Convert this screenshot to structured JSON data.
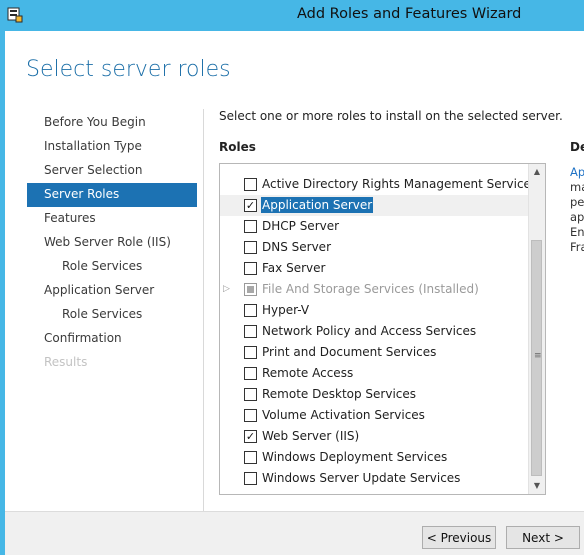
{
  "window": {
    "title": "Add Roles and Features Wizard",
    "icon": "server-manager-icon",
    "accent_color": "#46b7e6"
  },
  "page": {
    "title": "Select server roles"
  },
  "nav": {
    "items": [
      {
        "label": "Before You Begin",
        "level": 0,
        "state": "normal"
      },
      {
        "label": "Installation Type",
        "level": 0,
        "state": "normal"
      },
      {
        "label": "Server Selection",
        "level": 0,
        "state": "normal"
      },
      {
        "label": "Server Roles",
        "level": 0,
        "state": "active"
      },
      {
        "label": "Features",
        "level": 0,
        "state": "normal"
      },
      {
        "label": "Web Server Role (IIS)",
        "level": 0,
        "state": "normal"
      },
      {
        "label": "Role Services",
        "level": 1,
        "state": "normal"
      },
      {
        "label": "Application Server",
        "level": 0,
        "state": "normal"
      },
      {
        "label": "Role Services",
        "level": 1,
        "state": "normal"
      },
      {
        "label": "Confirmation",
        "level": 0,
        "state": "normal"
      },
      {
        "label": "Results",
        "level": 0,
        "state": "disabled"
      }
    ]
  },
  "main": {
    "instruction": "Select one or more roles to install on the selected server.",
    "roles_heading": "Roles",
    "description_heading": "De",
    "description_lines": [
      "Ap",
      "ma",
      "pe",
      "app",
      "Ent",
      "Fra"
    ]
  },
  "roles": [
    {
      "label": "Active Directory Rights Management Services",
      "checked": false
    },
    {
      "label": "Application Server",
      "checked": true,
      "selected": true
    },
    {
      "label": "DHCP Server",
      "checked": false
    },
    {
      "label": "DNS Server",
      "checked": false
    },
    {
      "label": "Fax Server",
      "checked": false
    },
    {
      "label": "File And Storage Services (Installed)",
      "checked": "partial",
      "expandable": true,
      "disabled": true
    },
    {
      "label": "Hyper-V",
      "checked": false
    },
    {
      "label": "Network Policy and Access Services",
      "checked": false
    },
    {
      "label": "Print and Document Services",
      "checked": false
    },
    {
      "label": "Remote Access",
      "checked": false
    },
    {
      "label": "Remote Desktop Services",
      "checked": false
    },
    {
      "label": "Volume Activation Services",
      "checked": false
    },
    {
      "label": "Web Server (IIS)",
      "checked": true
    },
    {
      "label": "Windows Deployment Services",
      "checked": false
    },
    {
      "label": "Windows Server Update Services",
      "checked": false
    }
  ],
  "footer": {
    "previous_label": "< Previous",
    "next_label": "Next >"
  }
}
